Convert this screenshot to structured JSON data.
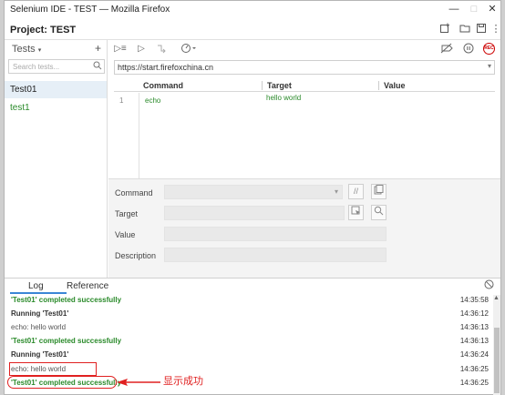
{
  "window": {
    "title": "Selenium IDE - TEST — Mozilla Firefox",
    "controls": [
      "—",
      "□",
      "✕"
    ]
  },
  "project": {
    "label": "Project: TEST"
  },
  "tests_panel": {
    "header": "Tests",
    "add": "+",
    "search_placeholder": "Search tests...",
    "items": [
      {
        "label": "Test01",
        "selected": true
      },
      {
        "label": "test1",
        "selected": false
      }
    ]
  },
  "url": "https://start.firefoxchina.cn",
  "table": {
    "headers": [
      "Command",
      "Target",
      "Value"
    ],
    "rows": [
      {
        "num": "1",
        "command": "echo",
        "target": "hello world",
        "value": ""
      }
    ]
  },
  "details": {
    "command_label": "Command",
    "target_label": "Target",
    "value_label": "Value",
    "description_label": "Description"
  },
  "log": {
    "tabs": [
      "Log",
      "Reference"
    ],
    "lines": [
      {
        "msg": "'Test01' completed successfully",
        "ts": "14:35:58",
        "kind": "ok"
      },
      {
        "msg": "Running 'Test01'",
        "ts": "14:36:12",
        "kind": "run"
      },
      {
        "msg": "echo: hello world",
        "ts": "14:36:13",
        "kind": "echo"
      },
      {
        "msg": "'Test01' completed successfully",
        "ts": "14:36:13",
        "kind": "ok"
      },
      {
        "msg": "Running 'Test01'",
        "ts": "14:36:24",
        "kind": "run"
      },
      {
        "msg": "echo: hello world",
        "ts": "14:36:25",
        "kind": "echo"
      },
      {
        "msg": "'Test01' completed successfully",
        "ts": "14:36:25",
        "kind": "ok"
      }
    ]
  },
  "annotation": {
    "text": "显示成功"
  },
  "colors": {
    "success": "#2a8a2a",
    "annotation": "#e02020",
    "tab_active": "#3b86d6"
  }
}
